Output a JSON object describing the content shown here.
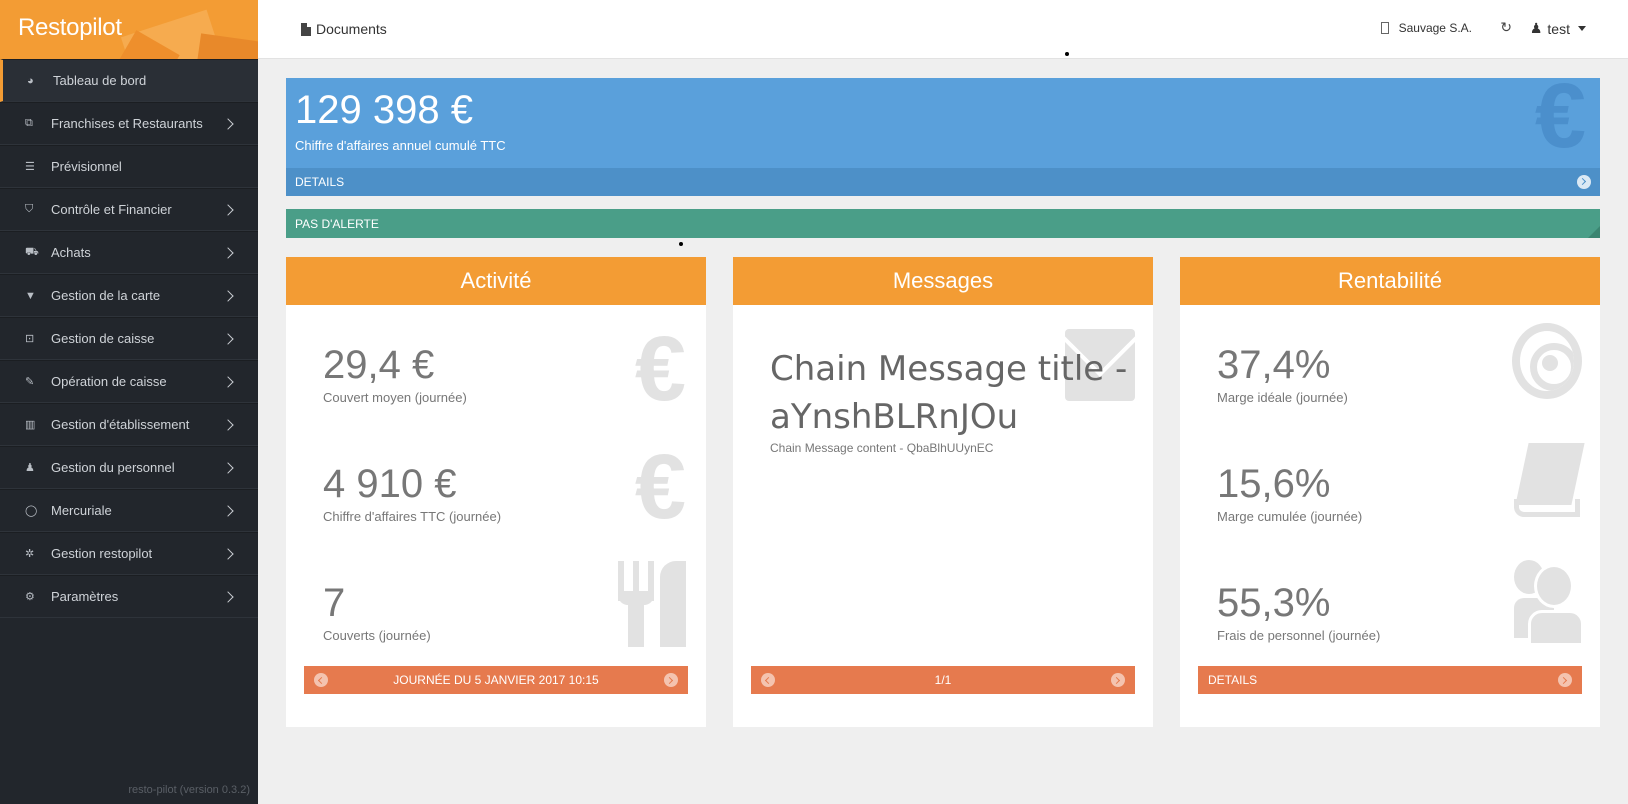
{
  "brand": {
    "name": "Restopilot",
    "color": "#f39c34"
  },
  "sidebar": {
    "items": [
      {
        "label": "Tableau de bord",
        "icon": "dashboard-icon",
        "glyph": "◕",
        "active": true,
        "has_submenu": false
      },
      {
        "label": "Franchises et Restaurants",
        "icon": "cubes-icon",
        "glyph": "⧉",
        "has_submenu": true
      },
      {
        "label": "Prévisionnel",
        "icon": "list-icon",
        "glyph": "☰",
        "has_submenu": false
      },
      {
        "label": "Contrôle et Financier",
        "icon": "shield-icon",
        "glyph": "⛉",
        "has_submenu": true
      },
      {
        "label": "Achats",
        "icon": "cart-icon",
        "glyph": "⛟",
        "has_submenu": true
      },
      {
        "label": "Gestion de la carte",
        "icon": "glass-icon",
        "glyph": "▼",
        "has_submenu": true
      },
      {
        "label": "Gestion de caisse",
        "icon": "money-icon",
        "glyph": "⊡",
        "has_submenu": true
      },
      {
        "label": "Opération de caisse",
        "icon": "edit-icon",
        "glyph": "✎",
        "has_submenu": true
      },
      {
        "label": "Gestion d'établissement",
        "icon": "building-icon",
        "glyph": "▥",
        "has_submenu": true
      },
      {
        "label": "Gestion du personnel",
        "icon": "user-tie-icon",
        "glyph": "♟",
        "has_submenu": true
      },
      {
        "label": "Mercuriale",
        "icon": "comment-icon",
        "glyph": "◯",
        "has_submenu": true
      },
      {
        "label": "Gestion restopilot",
        "icon": "gear-icon",
        "glyph": "✲",
        "has_submenu": true
      },
      {
        "label": "Paramètres",
        "icon": "gears-icon",
        "glyph": "⚙",
        "has_submenu": true
      }
    ],
    "version": "resto-pilot (version 0.3.2)"
  },
  "topbar": {
    "documents_label": "Documents",
    "company": "Sauvage S.A.",
    "refresh_glyph": "↻",
    "user": "test"
  },
  "revenue": {
    "value": "129 398 €",
    "label": "Chiffre d'affaires annuel cumulé TTC",
    "details_label": "DETAILS",
    "icon": "euro-icon",
    "bg_color": "#5aa0db"
  },
  "alert": {
    "label": "PAS D'ALERTE",
    "color": "#4a9e88"
  },
  "panels": {
    "activite": {
      "title": "Activité",
      "stats": [
        {
          "value": "29,4 €",
          "label": "Couvert moyen (journée)",
          "icon": "euro-icon"
        },
        {
          "value": "4 910 €",
          "label": "Chiffre d'affaires TTC (journée)",
          "icon": "euro-icon"
        },
        {
          "value": "7",
          "label": "Couverts (journée)",
          "icon": "cutlery-icon"
        }
      ],
      "footer": "JOURNÉE DU 5 JANVIER 2017 10:15"
    },
    "messages": {
      "title": "Messages",
      "message_title": "Chain Message title - aYnshBLRnJOu",
      "message_content": "Chain Message content - QbaBlhUUynEC",
      "icon": "envelope-icon",
      "footer": "1/1"
    },
    "rentabilite": {
      "title": "Rentabilité",
      "stats": [
        {
          "value": "37,4%",
          "label": "Marge idéale (journée)",
          "icon": "target-icon"
        },
        {
          "value": "15,6%",
          "label": "Marge cumulée (journée)",
          "icon": "book-icon"
        },
        {
          "value": "55,3%",
          "label": "Frais de personnel (journée)",
          "icon": "users-icon"
        }
      ],
      "footer": "DETAILS"
    }
  },
  "euro_glyph": "€"
}
